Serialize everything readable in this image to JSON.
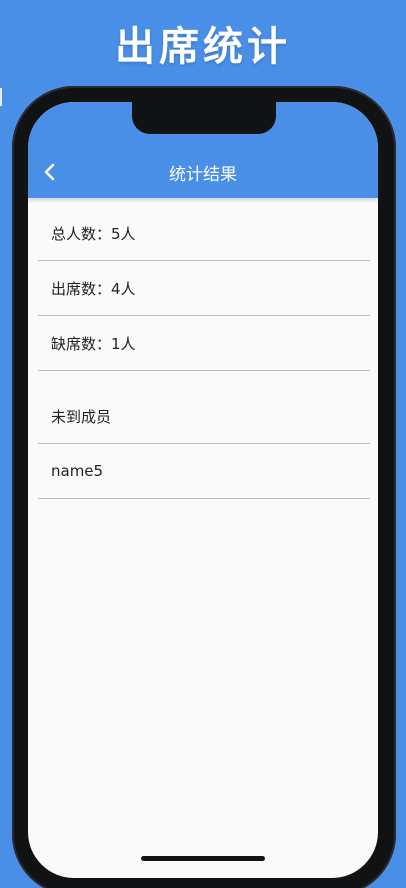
{
  "promo": {
    "title": "出席统计"
  },
  "appbar": {
    "title": "统计结果",
    "back_icon": "chevron-left-icon"
  },
  "stats": {
    "total": "总人数：5人",
    "present": "出席数：4人",
    "absent": "缺席数：1人"
  },
  "absent_section": {
    "header": "未到成员",
    "members": [
      "name5"
    ]
  },
  "colors": {
    "brand_blue": "#4a8fe7",
    "screen_bg": "#fafafa",
    "divider": "#bdbdbd",
    "frame": "#111214"
  }
}
